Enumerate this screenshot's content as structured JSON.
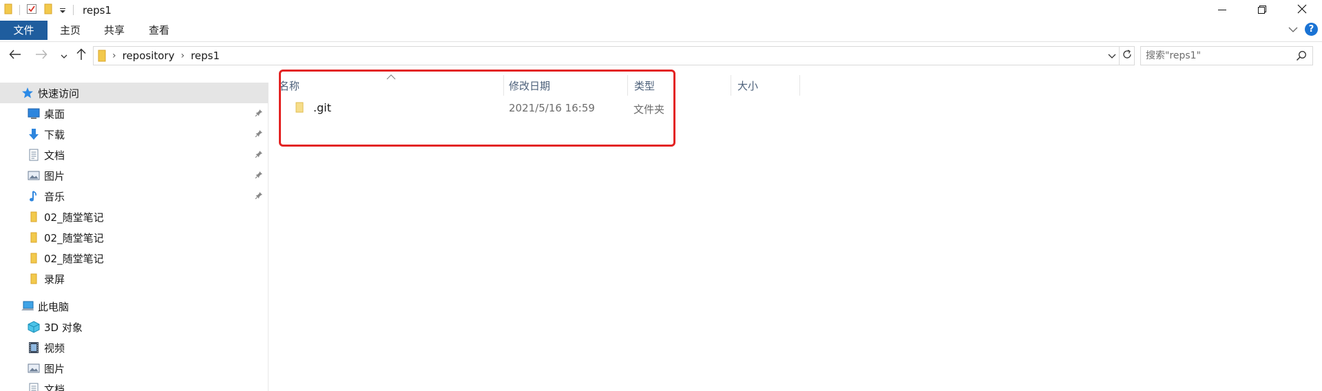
{
  "window": {
    "title": "reps1",
    "controls": {
      "minimize": "minimize-icon",
      "restore": "restore-icon",
      "close": "close-icon"
    }
  },
  "ribbon": {
    "tabs": [
      {
        "label": "文件",
        "active": true
      },
      {
        "label": "主页"
      },
      {
        "label": "共享"
      },
      {
        "label": "查看"
      }
    ],
    "accent_color": "#1f5d9e"
  },
  "address": {
    "crumbs": [
      "repository",
      "reps1"
    ],
    "search_placeholder": "搜索\"reps1\""
  },
  "sidebar": {
    "quick_access": {
      "label": "快速访问",
      "items": [
        {
          "label": "桌面",
          "icon": "desktop-icon",
          "pinned": true
        },
        {
          "label": "下载",
          "icon": "download-icon",
          "pinned": true
        },
        {
          "label": "文档",
          "icon": "document-icon",
          "pinned": true
        },
        {
          "label": "图片",
          "icon": "pictures-icon",
          "pinned": true
        },
        {
          "label": "音乐",
          "icon": "music-icon",
          "pinned": true
        },
        {
          "label": "02_随堂笔记",
          "icon": "folder-icon"
        },
        {
          "label": "02_随堂笔记",
          "icon": "folder-icon"
        },
        {
          "label": "02_随堂笔记",
          "icon": "folder-icon"
        },
        {
          "label": "录屏",
          "icon": "folder-icon"
        }
      ]
    },
    "this_pc": {
      "label": "此电脑",
      "items": [
        {
          "label": "3D 对象",
          "icon": "3d-objects-icon"
        },
        {
          "label": "视频",
          "icon": "video-icon"
        },
        {
          "label": "图片",
          "icon": "pictures-icon"
        },
        {
          "label": "文档",
          "icon": "document-icon"
        }
      ]
    }
  },
  "content": {
    "columns": [
      "名称",
      "修改日期",
      "类型",
      "大小"
    ],
    "files": [
      {
        "name": ".git",
        "modified": "2021/5/16 16:59",
        "type": "文件夹",
        "size": ""
      }
    ],
    "highlight_color": "#e32222"
  }
}
